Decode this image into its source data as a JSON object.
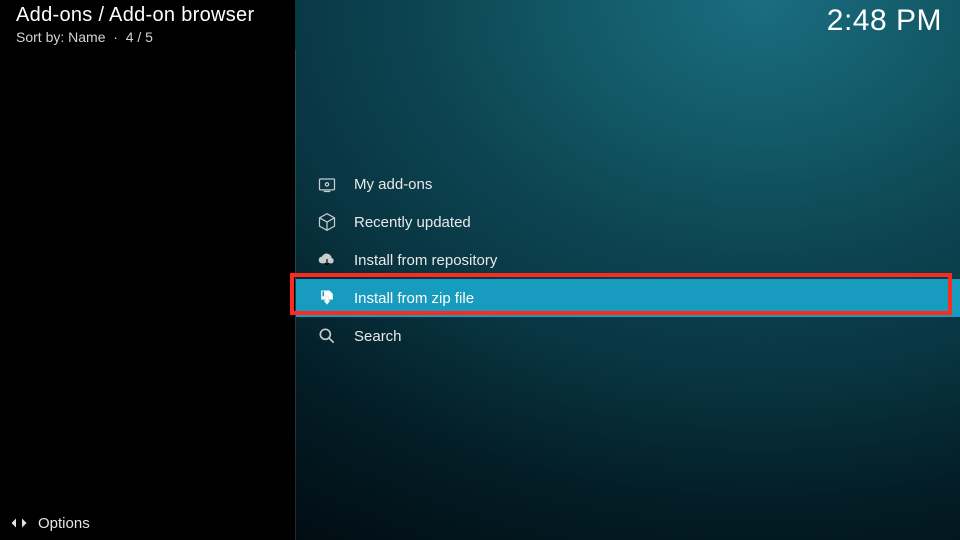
{
  "header": {
    "breadcrumb": "Add-ons / Add-on browser",
    "sort_label": "Sort by: Name",
    "position": "4 / 5"
  },
  "clock": "2:48 PM",
  "menu": {
    "items": [
      {
        "label": "My add-ons",
        "icon": "addons-icon"
      },
      {
        "label": "Recently updated",
        "icon": "box-icon"
      },
      {
        "label": "Install from repository",
        "icon": "cloud-download-icon"
      },
      {
        "label": "Install from zip file",
        "icon": "zip-download-icon"
      },
      {
        "label": "Search",
        "icon": "search-icon"
      }
    ],
    "selected_index": 3
  },
  "footer": {
    "options_label": "Options"
  }
}
